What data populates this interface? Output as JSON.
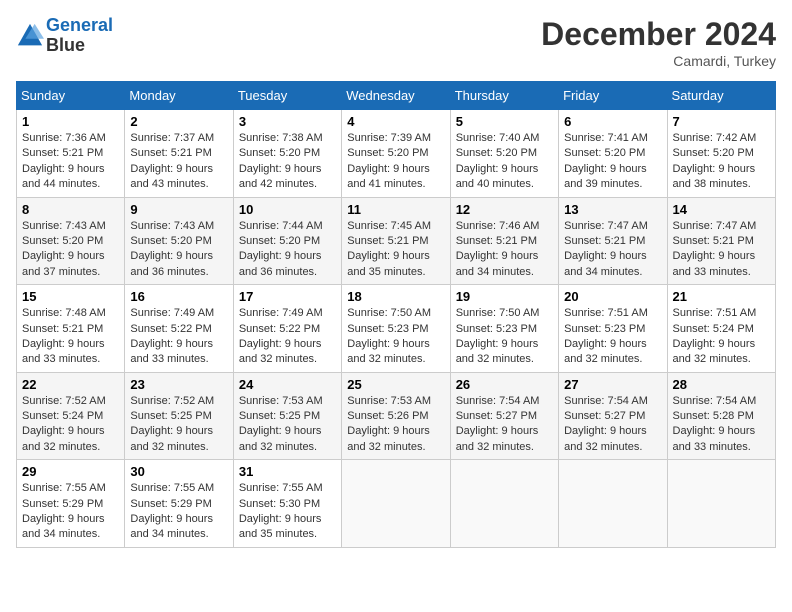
{
  "header": {
    "logo_line1": "General",
    "logo_line2": "Blue",
    "month": "December 2024",
    "location": "Camardi, Turkey"
  },
  "days_of_week": [
    "Sunday",
    "Monday",
    "Tuesday",
    "Wednesday",
    "Thursday",
    "Friday",
    "Saturday"
  ],
  "weeks": [
    [
      {
        "day": 1,
        "sunrise": "7:36 AM",
        "sunset": "5:21 PM",
        "daylight": "9 hours and 44 minutes."
      },
      {
        "day": 2,
        "sunrise": "7:37 AM",
        "sunset": "5:21 PM",
        "daylight": "9 hours and 43 minutes."
      },
      {
        "day": 3,
        "sunrise": "7:38 AM",
        "sunset": "5:20 PM",
        "daylight": "9 hours and 42 minutes."
      },
      {
        "day": 4,
        "sunrise": "7:39 AM",
        "sunset": "5:20 PM",
        "daylight": "9 hours and 41 minutes."
      },
      {
        "day": 5,
        "sunrise": "7:40 AM",
        "sunset": "5:20 PM",
        "daylight": "9 hours and 40 minutes."
      },
      {
        "day": 6,
        "sunrise": "7:41 AM",
        "sunset": "5:20 PM",
        "daylight": "9 hours and 39 minutes."
      },
      {
        "day": 7,
        "sunrise": "7:42 AM",
        "sunset": "5:20 PM",
        "daylight": "9 hours and 38 minutes."
      }
    ],
    [
      {
        "day": 8,
        "sunrise": "7:43 AM",
        "sunset": "5:20 PM",
        "daylight": "9 hours and 37 minutes."
      },
      {
        "day": 9,
        "sunrise": "7:43 AM",
        "sunset": "5:20 PM",
        "daylight": "9 hours and 36 minutes."
      },
      {
        "day": 10,
        "sunrise": "7:44 AM",
        "sunset": "5:20 PM",
        "daylight": "9 hours and 36 minutes."
      },
      {
        "day": 11,
        "sunrise": "7:45 AM",
        "sunset": "5:21 PM",
        "daylight": "9 hours and 35 minutes."
      },
      {
        "day": 12,
        "sunrise": "7:46 AM",
        "sunset": "5:21 PM",
        "daylight": "9 hours and 34 minutes."
      },
      {
        "day": 13,
        "sunrise": "7:47 AM",
        "sunset": "5:21 PM",
        "daylight": "9 hours and 34 minutes."
      },
      {
        "day": 14,
        "sunrise": "7:47 AM",
        "sunset": "5:21 PM",
        "daylight": "9 hours and 33 minutes."
      }
    ],
    [
      {
        "day": 15,
        "sunrise": "7:48 AM",
        "sunset": "5:21 PM",
        "daylight": "9 hours and 33 minutes."
      },
      {
        "day": 16,
        "sunrise": "7:49 AM",
        "sunset": "5:22 PM",
        "daylight": "9 hours and 33 minutes."
      },
      {
        "day": 17,
        "sunrise": "7:49 AM",
        "sunset": "5:22 PM",
        "daylight": "9 hours and 32 minutes."
      },
      {
        "day": 18,
        "sunrise": "7:50 AM",
        "sunset": "5:23 PM",
        "daylight": "9 hours and 32 minutes."
      },
      {
        "day": 19,
        "sunrise": "7:50 AM",
        "sunset": "5:23 PM",
        "daylight": "9 hours and 32 minutes."
      },
      {
        "day": 20,
        "sunrise": "7:51 AM",
        "sunset": "5:23 PM",
        "daylight": "9 hours and 32 minutes."
      },
      {
        "day": 21,
        "sunrise": "7:51 AM",
        "sunset": "5:24 PM",
        "daylight": "9 hours and 32 minutes."
      }
    ],
    [
      {
        "day": 22,
        "sunrise": "7:52 AM",
        "sunset": "5:24 PM",
        "daylight": "9 hours and 32 minutes."
      },
      {
        "day": 23,
        "sunrise": "7:52 AM",
        "sunset": "5:25 PM",
        "daylight": "9 hours and 32 minutes."
      },
      {
        "day": 24,
        "sunrise": "7:53 AM",
        "sunset": "5:25 PM",
        "daylight": "9 hours and 32 minutes."
      },
      {
        "day": 25,
        "sunrise": "7:53 AM",
        "sunset": "5:26 PM",
        "daylight": "9 hours and 32 minutes."
      },
      {
        "day": 26,
        "sunrise": "7:54 AM",
        "sunset": "5:27 PM",
        "daylight": "9 hours and 32 minutes."
      },
      {
        "day": 27,
        "sunrise": "7:54 AM",
        "sunset": "5:27 PM",
        "daylight": "9 hours and 32 minutes."
      },
      {
        "day": 28,
        "sunrise": "7:54 AM",
        "sunset": "5:28 PM",
        "daylight": "9 hours and 33 minutes."
      }
    ],
    [
      {
        "day": 29,
        "sunrise": "7:55 AM",
        "sunset": "5:29 PM",
        "daylight": "9 hours and 34 minutes."
      },
      {
        "day": 30,
        "sunrise": "7:55 AM",
        "sunset": "5:29 PM",
        "daylight": "9 hours and 34 minutes."
      },
      {
        "day": 31,
        "sunrise": "7:55 AM",
        "sunset": "5:30 PM",
        "daylight": "9 hours and 35 minutes."
      },
      null,
      null,
      null,
      null
    ]
  ]
}
